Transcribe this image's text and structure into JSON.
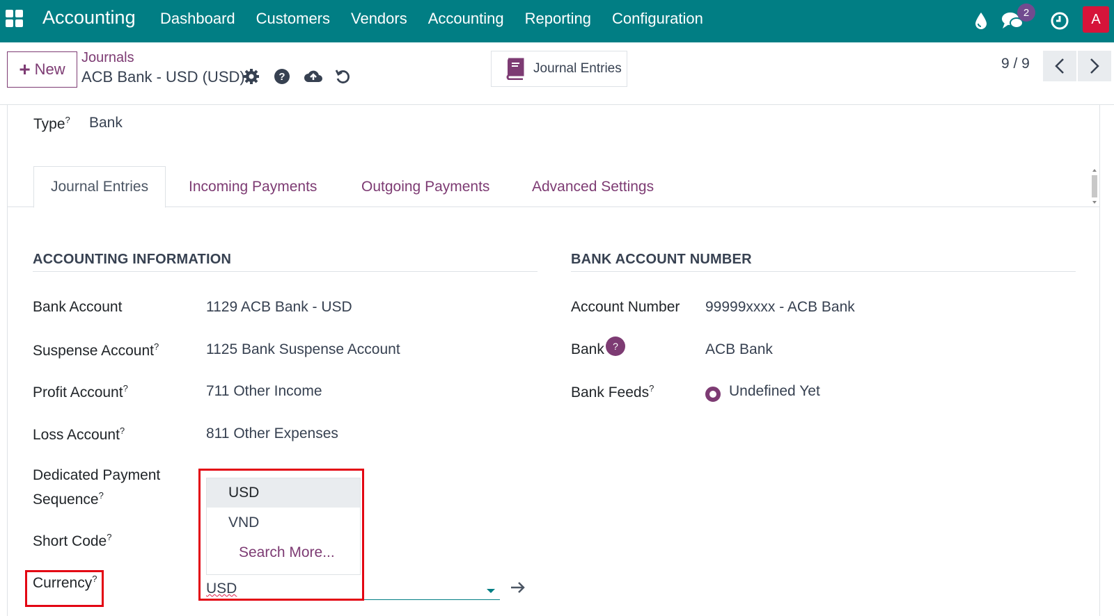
{
  "navbar": {
    "app_title": "Accounting",
    "menu": [
      "Dashboard",
      "Customers",
      "Vendors",
      "Accounting",
      "Reporting",
      "Configuration"
    ],
    "chat_badge": "2",
    "avatar_letter": "A"
  },
  "control_panel": {
    "new_label": "New",
    "breadcrumb_parent": "Journals",
    "breadcrumb_current": "ACB Bank - USD (USD)",
    "journal_entries_label": "Journal Entries",
    "pager": "9 / 9"
  },
  "form": {
    "type_label": "Type",
    "type_value": "Bank",
    "tabs": [
      "Journal Entries",
      "Incoming Payments",
      "Outgoing Payments",
      "Advanced Settings"
    ],
    "accounting_section_title": "ACCOUNTING INFORMATION",
    "bank_section_title": "BANK ACCOUNT NUMBER",
    "fields": {
      "bank_account": {
        "label": "Bank Account",
        "value": "1129 ACB Bank - USD"
      },
      "suspense_account": {
        "label": "Suspense Account",
        "value": "1125 Bank Suspense Account"
      },
      "profit_account": {
        "label": "Profit Account",
        "value": "711 Other Income"
      },
      "loss_account": {
        "label": "Loss Account",
        "value": "811 Other Expenses"
      },
      "dedicated_payment_sequence": {
        "label_line1": "Dedicated Payment",
        "label_line2": "Sequence"
      },
      "short_code": {
        "label": "Short Code"
      },
      "currency": {
        "label": "Currency",
        "value": "USD"
      },
      "account_number": {
        "label": "Account Number",
        "value": "99999xxxx - ACB Bank"
      },
      "bank": {
        "label": "Bank",
        "value": "ACB Bank"
      },
      "bank_feeds": {
        "label": "Bank Feeds",
        "value": "Undefined Yet"
      }
    },
    "tooltip_mark": "?",
    "currency_dropdown": {
      "options": [
        "USD",
        "VND"
      ],
      "selected": "USD",
      "search_more": "Search More..."
    }
  },
  "colors": {
    "navbar": "#017e84",
    "accent": "#7d3b73",
    "highlight_box": "#e30613"
  },
  "icons": [
    "apps-grid-icon",
    "droplet-icon",
    "chat-icon",
    "clock-icon",
    "gear-icon",
    "help-icon",
    "cloud-upload-icon",
    "undo-icon",
    "book-icon",
    "chevron-left-icon",
    "chevron-right-icon",
    "arrow-right-icon"
  ]
}
